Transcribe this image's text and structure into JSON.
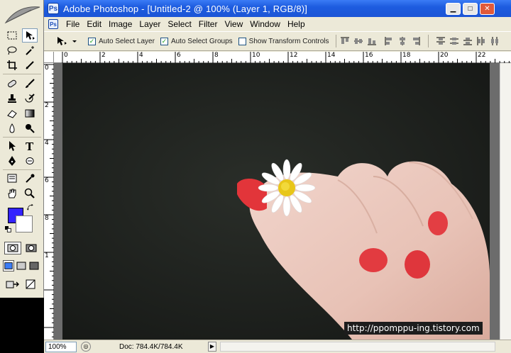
{
  "window": {
    "title": "Adobe Photoshop - [Untitled-2 @ 100% (Layer 1, RGB/8)]",
    "controls": {
      "minimize": "▁",
      "maximize": "□",
      "close": "✕"
    },
    "doc_controls": {
      "minimize": "▁",
      "restore": "❐",
      "close": "✕"
    }
  },
  "menu": {
    "items": [
      {
        "label": "File"
      },
      {
        "label": "Edit"
      },
      {
        "label": "Image"
      },
      {
        "label": "Layer"
      },
      {
        "label": "Select"
      },
      {
        "label": "Filter"
      },
      {
        "label": "View"
      },
      {
        "label": "Window"
      },
      {
        "label": "Help"
      }
    ]
  },
  "options": {
    "auto_select_layer": {
      "label": "Auto Select Layer",
      "checked": true
    },
    "auto_select_groups": {
      "label": "Auto Select Groups",
      "checked": true
    },
    "show_transform_controls": {
      "label": "Show Transform Controls",
      "checked": false
    },
    "check_mark": "✓"
  },
  "rulers": {
    "top_labels": [
      "0",
      "2",
      "4",
      "6",
      "8",
      "10",
      "12",
      "14",
      "16",
      "18",
      "20",
      "22"
    ],
    "left_labels": [
      "0",
      "2",
      "4",
      "6",
      "8",
      "1"
    ]
  },
  "colors": {
    "foreground": "#3322ff",
    "background": "#ffffff",
    "titlebar": "#1d5ce0"
  },
  "canvas": {
    "watermark": "http://ppomppu-ing.tistory.com"
  },
  "status": {
    "zoom": "100%",
    "doc_info": "Doc: 784.4K/784.4K",
    "arrow": "▶",
    "icon": "◎"
  }
}
